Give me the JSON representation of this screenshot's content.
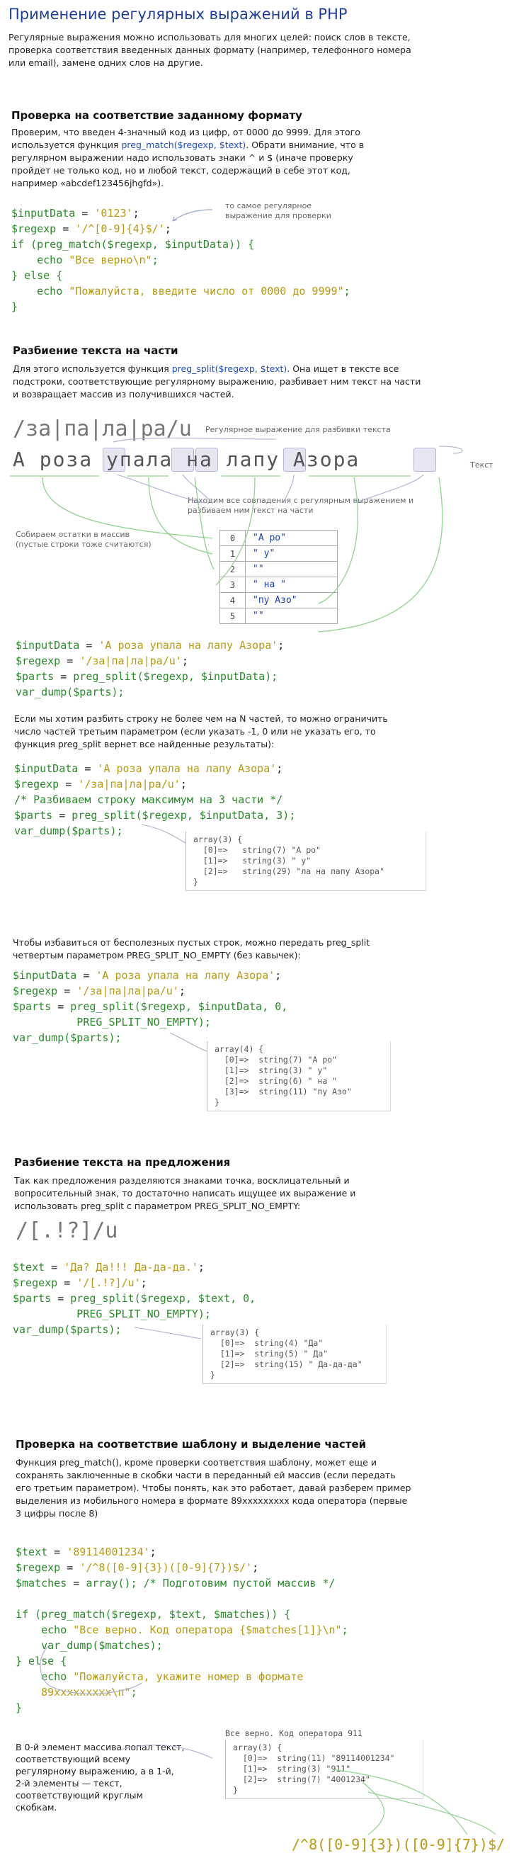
{
  "title": "Применение регулярных выражений в PHP",
  "intro": "Регулярные выражения можно использовать для многих целей: поиск слов в тексте, проверка соответствия введенных данных формату (например, телефонного номера или email), замене одних слов на другие.",
  "s1": {
    "heading": "Проверка на соответствие заданному формату",
    "p_a": "Проверим, что введен 4-значный код из цифр, от 0000 до 9999. Для этого используется функция ",
    "p_link": "preg_match($regexp, $text)",
    "p_b": ". Обрати внимание, что в регулярном выражении надо использовать знаки ^ и $ (иначе проверку пройдет не только код, но и любой текст, содержащий в себе этот код, например «abcdef123456jhgfd»).",
    "note": "то самое регулярное выражение для проверки",
    "code": {
      "l1_v": "$inputData",
      "l1_op": " = ",
      "l1_s": "'0123'",
      "l1_e": ";",
      "l2_v": "$regexp",
      "l2_op": " = ",
      "l2_s": "'/^[0-9]{4}$/'",
      "l2_e": ";",
      "l3_a": "if (",
      "l3_f": "preg_match",
      "l3_b": "(",
      "l3_v1": "$regexp",
      "l3_c": ", ",
      "l3_v2": "$inputData",
      "l3_d": ")) {",
      "l4_a": "    echo ",
      "l4_s": "\"Все верно\\n\"",
      "l4_e": ";",
      "l5": "} else {",
      "l6_a": "    echo ",
      "l6_s": "\"Пожалуйста, введите число от 0000 до 9999\"",
      "l6_e": ";",
      "l7": "}"
    }
  },
  "s2": {
    "heading": "Разбиение текста на части",
    "p_a": "Для этого используется функция ",
    "p_link": "preg_split($regexp, $text)",
    "p_b": ". Она ищет в тексте все подстроки, соответствующие регулярному выражению, разбивает ним текст на части и возвращает массив из получившихся частей.",
    "regex": "/за|па|ла|ра/u",
    "regex_note": "Регулярное выражение для разбивки текста",
    "text": "А роза упала на лапу Азора",
    "text_note": "Текст",
    "matches_note": "Находим все совпадения с регулярным выражением и разбиваем ним текст на части",
    "collect_note": "Собираем остатки в массив (пустые строки тоже считаются)",
    "array": [
      {
        "i": "0",
        "v": "\"А ро\""
      },
      {
        "i": "1",
        "v": "\" у\""
      },
      {
        "i": "2",
        "v": "\"\""
      },
      {
        "i": "3",
        "v": "\" на \""
      },
      {
        "i": "4",
        "v": "\"пу Азо\""
      },
      {
        "i": "5",
        "v": "\"\""
      }
    ],
    "code1": {
      "l1_v": "$inputData",
      "l1_op": " = ",
      "l1_s": "'А роза упала на лапу Азора'",
      "l1_e": ";",
      "l2_v": "$regexp",
      "l2_op": " = ",
      "l2_s": "'/за|па|ла|ра/u'",
      "l2_e": ";",
      "l3_v": "$parts",
      "l3_op": " = ",
      "l3_f": "preg_split",
      "l3_a": "(",
      "l3_v1": "$regexp",
      "l3_b": ", ",
      "l3_v2": "$inputData",
      "l3_e": ");",
      "l4_f": "var_dump",
      "l4_a": "(",
      "l4_v": "$parts",
      "l4_e": ");"
    },
    "p2": "Если мы хотим разбить строку не более чем на N частей, то можно ограничить число частей третьим параметром (если указать -1, 0 или не указать его, то функция preg_split вернет все найденные результаты):",
    "code2": {
      "l1_v": "$inputData",
      "l1_op": " = ",
      "l1_s": "'А роза упала на лапу Азора'",
      "l1_e": ";",
      "l2_v": "$regexp",
      "l2_op": " = ",
      "l2_s": "'/за|па|ла|ра/u'",
      "l2_e": ";",
      "l3": "/* Разбиваем строку максимум на 3 части */",
      "l4_v": "$parts",
      "l4_op": " = ",
      "l4_f": "preg_split",
      "l4_a": "(",
      "l4_v1": "$regexp",
      "l4_b": ", ",
      "l4_v2": "$inputData",
      "l4_c": ", 3);",
      "l5_f": "var_dump",
      "l5_a": "(",
      "l5_v": "$parts",
      "l5_e": ");"
    },
    "dump2": "array(3) {\n  [0]=>   string(7) \"А ро\"\n  [1]=>   string(3) \" у\"\n  [2]=>   string(29) \"ла на лапу Азора\"\n}",
    "p3": "Чтобы избавиться от бесполезных пустых строк, можно передать preg_split четвертым параметром PREG_SPLIT_NO_EMPTY (без кавычек):",
    "code3": {
      "l1_v": "$inputData",
      "l1_op": " = ",
      "l1_s": "'А роза упала на лапу Азора'",
      "l1_e": ";",
      "l2_v": "$regexp",
      "l2_op": " = ",
      "l2_s": "'/за|па|ла|ра/u'",
      "l2_e": ";",
      "l3_v": "$parts",
      "l3_op": " = ",
      "l3_f": "preg_split",
      "l3_a": "(",
      "l3_v1": "$regexp",
      "l3_b": ", ",
      "l3_v2": "$inputData",
      "l3_c": ", 0,",
      "l4": "          PREG_SPLIT_NO_EMPTY);",
      "l5_f": "var_dump",
      "l5_a": "(",
      "l5_v": "$parts",
      "l5_e": ");"
    },
    "dump3": "array(4) {\n  [0]=>  string(7) \"А ро\"\n  [1]=>  string(3) \" у\"\n  [2]=>  string(6) \" на \"\n  [3]=>  string(11) \"пу Азо\"\n}"
  },
  "s3": {
    "heading": "Разбиение текста на предложения",
    "p": "Так как предложения разделяются знаками точка, восклицательный и вопросительный знак, то достаточно написать ищущее их выражение и использовать preg_split с параметром PREG_SPLIT_NO_EMPTY:",
    "regex": "/[.!?]/u",
    "code": {
      "l1_v": "$text",
      "l1_op": " = ",
      "l1_s": "'Да? Да!!! Да-да-да.'",
      "l1_e": ";",
      "l2_v": "$regexp",
      "l2_op": " = ",
      "l2_s": "'/[.!?]/u'",
      "l2_e": ";",
      "l3_v": "$parts",
      "l3_op": " = ",
      "l3_f": "preg_split",
      "l3_a": "(",
      "l3_v1": "$regexp",
      "l3_b": ", ",
      "l3_v2": "$text",
      "l3_c": ", 0,",
      "l4": "          PREG_SPLIT_NO_EMPTY);",
      "l5_f": "var_dump",
      "l5_a": "(",
      "l5_v": "$parts",
      "l5_e": ");"
    },
    "dump": "array(3) {\n  [0]=>  string(4) \"Да\"\n  [1]=>  string(5) \" Да\"\n  [2]=>  string(15) \" Да-да-да\"\n}"
  },
  "s4": {
    "heading": "Проверка на соответствие шаблону и выделение частей",
    "p": "Функция preg_match(), кроме проверки соответствия шаблону, может еще и сохранять заключенные в скобки части в переданный ей массив (если передать его третьим параметром). Чтобы понять, как это работает, давай разберем пример выделения из мобильного номера в формате 89xxxxxxxxx кода оператора (первые 3 цифры после 8)",
    "code": {
      "l1_v": "$text",
      "l1_op": " = ",
      "l1_s": "'89114001234'",
      "l1_e": ";",
      "l2_v": "$regexp",
      "l2_op": " = ",
      "l2_s": "'/^8([0-9]{3})([0-9]{7})$/'",
      "l2_e": ";",
      "l3_v": "$matches",
      "l3_op": " = ",
      "l3_f": "array",
      "l3_e": "(); /* Подготовим пустой массив */",
      "l5_a": "if (",
      "l5_f": "preg_match",
      "l5_b": "(",
      "l5_v1": "$regexp",
      "l5_c": ", ",
      "l5_v2": "$text",
      "l5_d": ", ",
      "l5_v3": "$matches",
      "l5_e": ")) {",
      "l6_a": "    echo ",
      "l6_s": "\"Все верно. Код оператора {$matches[1]}\\n\"",
      "l6_e": ";",
      "l7_a": "    ",
      "l7_f": "var_dump",
      "l7_b": "(",
      "l7_v": "$matches",
      "l7_e": ");",
      "l8": "} else {",
      "l9_a": "    echo ",
      "l9_s": "\"Пожалуйста, укажите номер в формате",
      "l10_s": "    89xxxxxxxxx\\n\"",
      "l10_e": ";",
      "l11": "}"
    },
    "note": "В 0-й элемент массива попал текст, соответствующий всему регулярному выражению, а в 1-й, 2-й элементы — текст, соответствующий круглым скобкам.",
    "output_line": "Все верно. Код оператора 911",
    "dump": "array(3) {\n  [0]=>  string(11) \"89114001234\"\n  [1]=>  string(3) \"911\"\n  [2]=>  string(7) \"4001234\"\n}",
    "regex_big": "/^8([0-9]{3})([0-9]{7})$/"
  }
}
